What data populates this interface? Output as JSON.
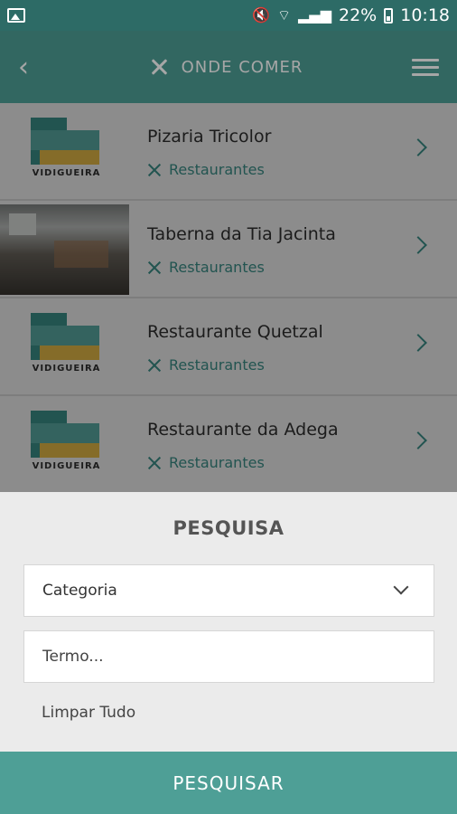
{
  "status_bar": {
    "battery": "22%",
    "time": "10:18",
    "icons": [
      "image-icon",
      "mute-icon",
      "wifi-icon",
      "signal-icon",
      "battery-icon"
    ]
  },
  "app_bar": {
    "title": "ONDE COMER",
    "back_icon": "back-arrow-icon",
    "category_icon": "cutlery-icon",
    "menu_icon": "hamburger-icon"
  },
  "list": {
    "items": [
      {
        "name": "Pizaria Tricolor",
        "category": "Restaurantes",
        "thumb": "logo",
        "logo_text": "VIDIGUEIRA"
      },
      {
        "name": "Taberna da Tia Jacinta",
        "category": "Restaurantes",
        "thumb": "photo",
        "logo_text": ""
      },
      {
        "name": "Restaurante Quetzal",
        "category": "Restaurantes",
        "thumb": "logo",
        "logo_text": "VIDIGUEIRA"
      },
      {
        "name": "Restaurante da Adega",
        "category": "Restaurantes",
        "thumb": "logo",
        "logo_text": "VIDIGUEIRA"
      }
    ]
  },
  "search": {
    "heading": "PESQUISA",
    "category_select": {
      "selected": "Categoria"
    },
    "term_input": {
      "value": "",
      "placeholder": "Termo..."
    },
    "clear_label": "Limpar Tudo",
    "submit_label": "PESQUISAR"
  },
  "colors": {
    "primary": "#4e9f96",
    "status_bar": "#2d6b66",
    "sheet_bg": "#ebebeb"
  }
}
